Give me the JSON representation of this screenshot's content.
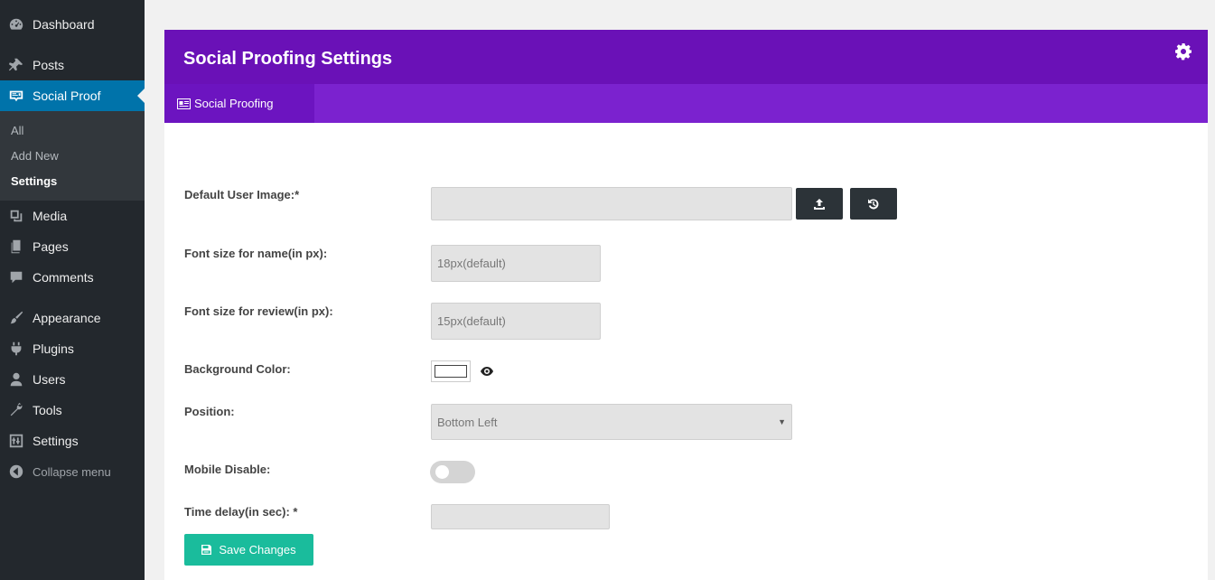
{
  "sidebar": {
    "items": [
      {
        "label": "Dashboard",
        "icon": "dashboard-icon"
      },
      {
        "label": "Posts",
        "icon": "pin-icon"
      },
      {
        "label": "Social Proof",
        "icon": "social-proof-icon",
        "active": true
      },
      {
        "label": "Media",
        "icon": "media-icon"
      },
      {
        "label": "Pages",
        "icon": "pages-icon"
      },
      {
        "label": "Comments",
        "icon": "comments-icon"
      },
      {
        "label": "Appearance",
        "icon": "paintbrush-icon"
      },
      {
        "label": "Plugins",
        "icon": "plugins-icon"
      },
      {
        "label": "Users",
        "icon": "users-icon"
      },
      {
        "label": "Tools",
        "icon": "wrench-icon"
      },
      {
        "label": "Settings",
        "icon": "settings-icon"
      }
    ],
    "submenu": [
      "All",
      "Add New",
      "Settings"
    ],
    "collapse_label": "Collapse menu"
  },
  "panel": {
    "title": "Social Proofing Settings",
    "tab_label": "Social Proofing"
  },
  "form": {
    "default_image_label": "Default User Image:*",
    "default_image_value": "",
    "font_name_label": "Font size for name(in px):",
    "font_name_placeholder": "18px(default)",
    "font_review_label": "Font size for review(in px):",
    "font_review_placeholder": "15px(default)",
    "bg_color_label": "Background Color:",
    "bg_color_value": "#ffffff",
    "position_label": "Position:",
    "position_value": "Bottom Left",
    "mobile_disable_label": "Mobile Disable:",
    "mobile_disable_on": false,
    "time_delay_label": "Time delay(in sec): *",
    "time_delay_value": "",
    "save_label": "Save Changes"
  },
  "colors": {
    "sidebar_bg": "#23282d",
    "active_blue": "#0073aa",
    "header_purple": "#6a11b7",
    "tabbar_purple": "#7b22cf",
    "save_green": "#1abc9c"
  }
}
